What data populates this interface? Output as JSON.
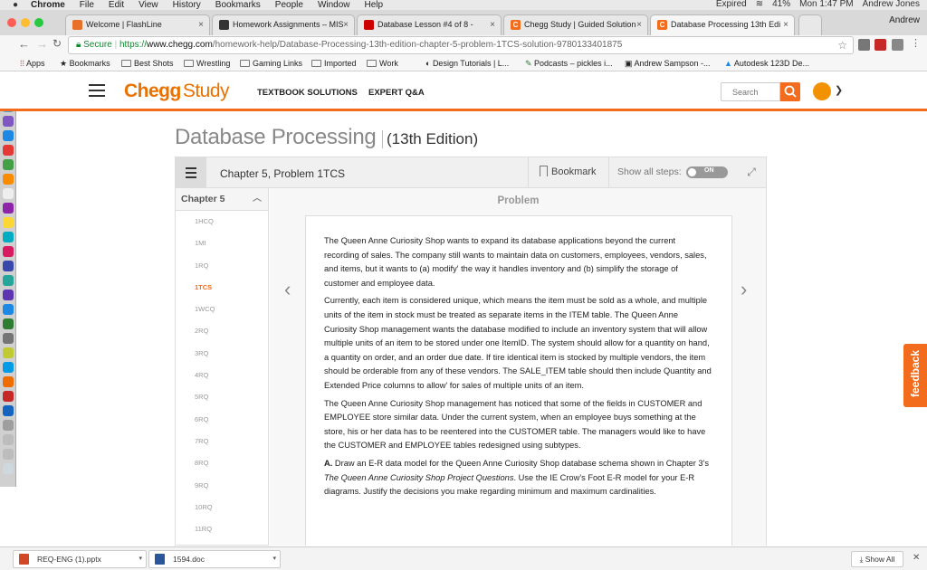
{
  "menubar": {
    "app": "Chrome",
    "items": [
      "File",
      "Edit",
      "View",
      "History",
      "Bookmarks",
      "People",
      "Window",
      "Help"
    ],
    "expired": "Expired",
    "battery": "41%",
    "clock": "Mon 1:47 PM",
    "user": "Andrew Jones"
  },
  "tabs": [
    {
      "label": "Welcome | FlashLine",
      "color": "#e8712a"
    },
    {
      "label": "Homework Assignments – MIS",
      "color": "#333333"
    },
    {
      "label": "Database Lesson #4 of 8 -",
      "color": "#cc0000"
    },
    {
      "label": "Chegg Study | Guided Solution",
      "color": "#f36b1c"
    },
    {
      "label": "Database Processing 13th Edi",
      "color": "#f36b1c"
    }
  ],
  "profile": "Andrew",
  "address": {
    "secure": "Secure",
    "scheme": "https://",
    "host": "www.chegg.com",
    "path": "/homework-help/Database-Processing-13th-edition-chapter-5-problem-1TCS-solution-9780133401875"
  },
  "bookmarks": [
    {
      "label": "Apps",
      "icon": "apps-grid-icon"
    },
    {
      "label": "Bookmarks",
      "icon": "star-icon"
    },
    {
      "label": "Best Shots",
      "icon": "folder-icon"
    },
    {
      "label": "Wrestling",
      "icon": "folder-icon"
    },
    {
      "label": "Gaming Links",
      "icon": "folder-icon"
    },
    {
      "label": "Imported",
      "icon": "folder-icon"
    },
    {
      "label": "Work",
      "icon": "folder-icon"
    },
    {
      "label": "Design Tutorials | L...",
      "icon": "site-icon"
    },
    {
      "label": "Podcasts – pickles i...",
      "icon": "site-icon"
    },
    {
      "label": "Andrew Sampson -...",
      "icon": "site-icon"
    },
    {
      "label": "Autodesk 123D De...",
      "icon": "site-icon"
    }
  ],
  "header": {
    "logo_main": "Chegg",
    "logo_sub": "Study",
    "nav": [
      "TEXTBOOK SOLUTIONS",
      "EXPERT Q&A"
    ],
    "search_placeholder": "Search",
    "accent": "#f36b1c"
  },
  "book": {
    "title": "Database Processing",
    "edition": "(13th Edition)"
  },
  "solution_bar": {
    "chapter_problem": "Chapter 5, Problem 1TCS",
    "bookmark": "Bookmark",
    "show_steps": "Show all steps:",
    "toggle_label": "ON"
  },
  "chapter_list": {
    "heading": "Chapter 5",
    "items": [
      "1HCQ",
      "1MI",
      "1RQ",
      "1TCS",
      "1WCQ",
      "2RQ",
      "3RQ",
      "4RQ",
      "5RQ",
      "6RQ",
      "7RQ",
      "8RQ",
      "9RQ",
      "10RQ",
      "11RQ"
    ],
    "active": "1TCS"
  },
  "problem": {
    "label": "Problem",
    "p1": "The Queen Anne Curiosity Shop wants to expand its database applications beyond the current recording of sales. The company still wants to maintain data on customers, employees, vendors, sales, and items, but it wants to (a) modify' the way it handles inventory and (b) simplify the storage of customer and employee data.",
    "p2": "Currently, each item is considered unique, which means the item must be sold as a whole, and multiple units of the item in stock must be treated as separate items in the ITEM table. The Queen Anne Curiosity Shop management wants the database modified to include an inventory system that will allow multiple units of an item to be stored under one ItemID. The system should allow for a quantity on hand, a quantity on order, and an order due date. If tire identical item is stocked by multiple vendors, the item should be orderable from any of these vendors. The SALE_ITEM table should then include Quantity and Extended Price columns to allow' for sales of multiple units of an item.",
    "p3": "The Queen Anne Curiosity Shop management has noticed that some of the fields in CUSTOMER and EMPLOYEE store similar data. Under the current system, when an employee buys something at the store, his or her data has to be reentered into the CUSTOMER table. The managers would like to have the CUSTOMER and EMPLOYEE tables redesigned using subtypes.",
    "p4_label": "A.",
    "p4_a": " Draw an E-R data model for the Queen Anne Curiosity Shop database schema shown in Chapter 3's ",
    "p4_ital": "The Queen Anne Curiosity Shop Project Questions",
    "p4_b": ". Use the IE Crow's Foot E-R model for your E-R diagrams. Justify the decisions you make regarding minimum and maximum cardinalities."
  },
  "feedback": "feedback",
  "downloads": {
    "files": [
      {
        "name": "REQ-ENG (1).pptx",
        "color": "#d24726"
      },
      {
        "name": "1594.doc",
        "color": "#2b579a"
      }
    ],
    "show_all": "Show All"
  }
}
